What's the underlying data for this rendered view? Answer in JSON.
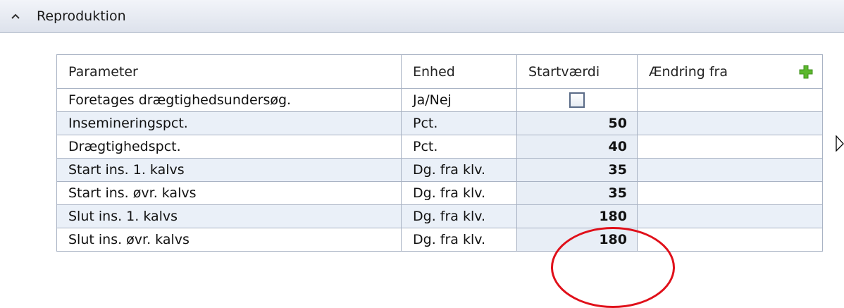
{
  "section": {
    "title": "Reproduktion",
    "collapse_icon": "chevron-up-icon"
  },
  "table": {
    "headers": {
      "parameter": "Parameter",
      "unit": "Enhed",
      "start_value": "Startværdi",
      "change_from": "Ændring fra",
      "add_icon": "plus-icon",
      "add_icon_color": "#5cb82e"
    },
    "rows": [
      {
        "parameter": "Foretages drægtighedsundersøg.",
        "unit": "Ja/Nej",
        "value": "",
        "type": "checkbox",
        "checked": false
      },
      {
        "parameter": "Insemineringspct.",
        "unit": "Pct.",
        "value": "50",
        "type": "number"
      },
      {
        "parameter": "Drægtighedspct.",
        "unit": "Pct.",
        "value": "40",
        "type": "number"
      },
      {
        "parameter": "Start ins. 1. kalvs",
        "unit": "Dg. fra klv.",
        "value": "35",
        "type": "number"
      },
      {
        "parameter": "Start ins. øvr. kalvs",
        "unit": "Dg. fra klv.",
        "value": "35",
        "type": "number"
      },
      {
        "parameter": "Slut ins. 1. kalvs",
        "unit": "Dg. fra klv.",
        "value": "180",
        "type": "number"
      },
      {
        "parameter": "Slut ins. øvr. kalvs",
        "unit": "Dg. fra klv.",
        "value": "180",
        "type": "number"
      }
    ]
  },
  "annotation": {
    "color": "#e0101a",
    "shape": "ellipse"
  }
}
